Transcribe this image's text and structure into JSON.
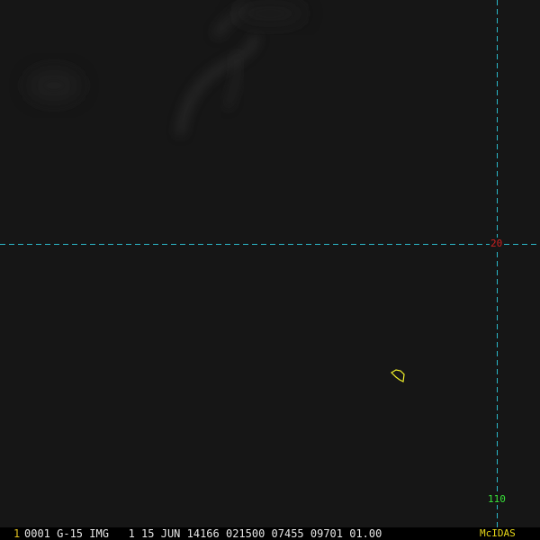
{
  "grid": {
    "latitude_label": "20",
    "longitude_label": "110"
  },
  "status_bar": {
    "frame_number": "1",
    "text": "0001 G-15 IMG   1 15 JUN 14166 021500 07455 09701 01.00",
    "brand": "McIDAS"
  },
  "colors": {
    "grid_line": "#2bb8c9",
    "latitude_label": "#cc2020",
    "longitude_label": "#38e038",
    "coastline": "#f2f22a",
    "frame_number": "#e0c020",
    "status_text": "#e6e6e6",
    "brand": "#e8d818",
    "background": "#161616"
  }
}
